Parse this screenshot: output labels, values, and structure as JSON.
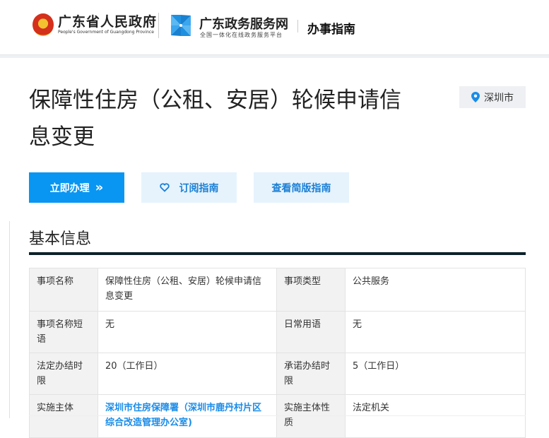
{
  "header": {
    "gov_title": "广东省人民政府",
    "gov_subtitle": "People's Government of Guangdong Province",
    "portal_title": "广东政务服务网",
    "portal_subtitle": "全国一体化在线政务服务平台",
    "section": "办事指南"
  },
  "page": {
    "title": "保障性住房（公租、安居）轮候申请信息变更",
    "location": "深圳市"
  },
  "buttons": {
    "apply": "立即办理",
    "apply_icon": "»",
    "subscribe": "订阅指南",
    "simple": "查看简版指南"
  },
  "basic_info": {
    "heading": "基本信息",
    "rows": [
      {
        "k1": "事项名称",
        "v1": "保障性住房（公租、安居）轮候申请信息变更",
        "k2": "事项类型",
        "v2": "公共服务"
      },
      {
        "k1": "事项名称短语",
        "v1": "无",
        "k2": "日常用语",
        "v2": "无"
      },
      {
        "k1": "法定办结时限",
        "v1": "20（工作日）",
        "k2": "承诺办结时限",
        "v2": "5（工作日）"
      },
      {
        "k1": "实施主体",
        "v1": "深圳市住房保障署（深圳市鹿丹村片区综合改造管理办公室)",
        "k2": "实施主体性质",
        "v2": "法定机关"
      }
    ]
  },
  "colors": {
    "primary": "#0996f3",
    "light": "#e6f3fd",
    "dark_bar": "#0d2229"
  }
}
